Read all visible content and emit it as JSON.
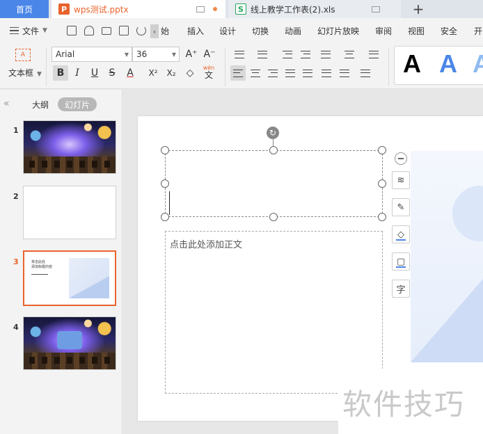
{
  "tabs": {
    "home": "首页",
    "active_doc": "wps测试.pptx",
    "xls_doc": "线上教学工作表(2).xls",
    "pptx_badge": "P",
    "xls_badge": "S",
    "new_tab": "+"
  },
  "menu": {
    "file": "文件",
    "items": [
      "始",
      "插入",
      "设计",
      "切换",
      "动画",
      "幻灯片放映",
      "审阅",
      "视图",
      "安全",
      "开"
    ]
  },
  "ribbon": {
    "textbox_label": "文本框",
    "textbox_icon_text": "A",
    "font_name": "Arial",
    "font_size": "36",
    "bold": "B",
    "italic": "I",
    "underline": "U",
    "strikethrough": "S",
    "font_color": "A",
    "superscript": "X²",
    "subscript": "X₂",
    "phonetic": "wén",
    "phonetic_char": "文",
    "grow_font": "A⁺",
    "shrink_font": "A⁻",
    "style_samples": [
      "A",
      "A",
      "A"
    ]
  },
  "left_panel": {
    "tab_outline": "大纲",
    "tab_slides": "幻灯片",
    "thumbnails": [
      {
        "num": "1"
      },
      {
        "num": "2"
      },
      {
        "num": "3",
        "title_line1": "单击此处",
        "title_line2": "添加标题内容"
      },
      {
        "num": "4"
      }
    ]
  },
  "slide": {
    "body_placeholder": "点击此处添加正文"
  },
  "floating_tools": {
    "text_tool": "字"
  },
  "watermark": "软件技巧",
  "colors": {
    "accent_orange": "#e8632c",
    "home_tab_blue": "#4a86e8",
    "xls_green": "#27a55c",
    "style_black": "#000000",
    "style_blue": "#4a86e8",
    "style_light_blue": "#8fbaf0"
  }
}
